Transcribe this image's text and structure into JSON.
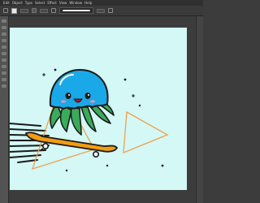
{
  "menu": [
    "Edit",
    "Object",
    "Type",
    "Select",
    "Effect",
    "View",
    "Window",
    "Help"
  ],
  "toolbar": {
    "mode_label": "",
    "opacity_label": "",
    "style_label": ""
  },
  "colors": {
    "canvas_bg": "#d3f8f6",
    "workspace_bg": "#3c3c3c",
    "jellyfish_body": "#1aa9e8",
    "tentacles": "#3aab5a",
    "skateboard": "#f39c12",
    "triangle": "#f0a04b",
    "outline": "#1a1a1a"
  },
  "artwork": {
    "subject": "jellyfish-on-skateboard illustration"
  }
}
